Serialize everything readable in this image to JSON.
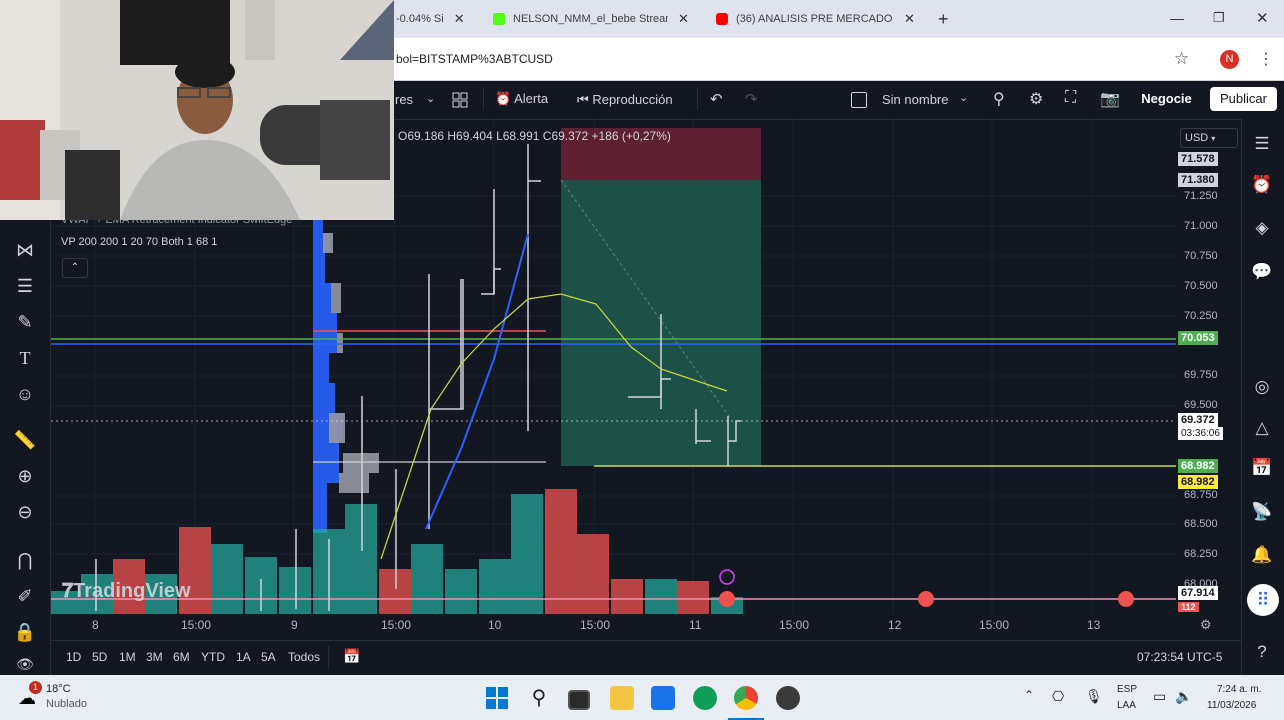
{
  "browser": {
    "tabs": [
      {
        "label": "-0.04% Si",
        "icon_color": "#e0e0e0"
      },
      {
        "label": "NELSON_NMM_el_bebe Stream",
        "icon_color": "#53fc18"
      },
      {
        "label": "(36) ANALISIS PRE MERCADO D",
        "icon_color": "#ff0000"
      }
    ],
    "new_tab": "+",
    "url": "bol=BITSTAMP%3ABTCUSD",
    "profile_initial": "N"
  },
  "toolbar": {
    "indicators": "res",
    "alert": "Alerta",
    "replay": "Reproducción",
    "layout_name": "Sin nombre",
    "trade": "Negocie",
    "publish": "Publicar"
  },
  "legend": {
    "ohlc": "O69.186 H69.404 L68.991 C69.372 +186 (+0,27%)",
    "indicator1": "VWAP + EMA Retracement Indicator SwiftEdge",
    "indicator2": "VP 200 200 1 20 70 Both 1 68 1"
  },
  "price_axis": {
    "currency": "USD",
    "labels": [
      "71.250",
      "71.000",
      "70.750",
      "70.500",
      "70.250",
      "69.750",
      "69.500",
      "68.750",
      "68.500",
      "68.250",
      "68.000"
    ],
    "tags": [
      {
        "value": "71.578",
        "bg": "#d1d4dc",
        "fg": "#131722"
      },
      {
        "value": "71.380",
        "bg": "#d1d4dc",
        "fg": "#131722"
      },
      {
        "value": "70.053",
        "bg": "#4caf50",
        "fg": "#ffffff"
      },
      {
        "value": "69.372",
        "bg": "#ffffff",
        "fg": "#131722"
      },
      {
        "value": "03:36:06",
        "bg": "#ffffff",
        "fg": "#131722"
      },
      {
        "value": "68.982",
        "bg": "#4caf50",
        "fg": "#ffffff"
      },
      {
        "value": "68.982",
        "bg": "#ffeb3b",
        "fg": "#131722"
      },
      {
        "value": "67.914",
        "bg": "#ffffff",
        "fg": "#131722"
      },
      {
        "value": "112",
        "bg": "#ef5350",
        "fg": "#ffffff"
      }
    ]
  },
  "time_axis": {
    "labels": [
      "8",
      "15:00",
      "9",
      "15:00",
      "10",
      "15:00",
      "11",
      "15:00",
      "12",
      "15:00",
      "13"
    ]
  },
  "range_bar": {
    "ranges": [
      "1D",
      "5D",
      "1M",
      "3M",
      "6M",
      "YTD",
      "1A",
      "5A",
      "Todos"
    ],
    "clock": "07:23:54 UTC-5"
  },
  "watermark": "TradingView",
  "taskbar": {
    "weather_temp": "18°C",
    "weather_desc": "Nublado",
    "weather_badge": "1",
    "lang1": "ESP",
    "lang2": "LAA",
    "time": "7:24 a. m.",
    "date": "11/03/2026"
  },
  "colors": {
    "bg": "#131722",
    "bull": "#26a69a",
    "bear": "#ef5350",
    "green_level": "#4caf50",
    "yellow_level": "#ffeb3b"
  }
}
